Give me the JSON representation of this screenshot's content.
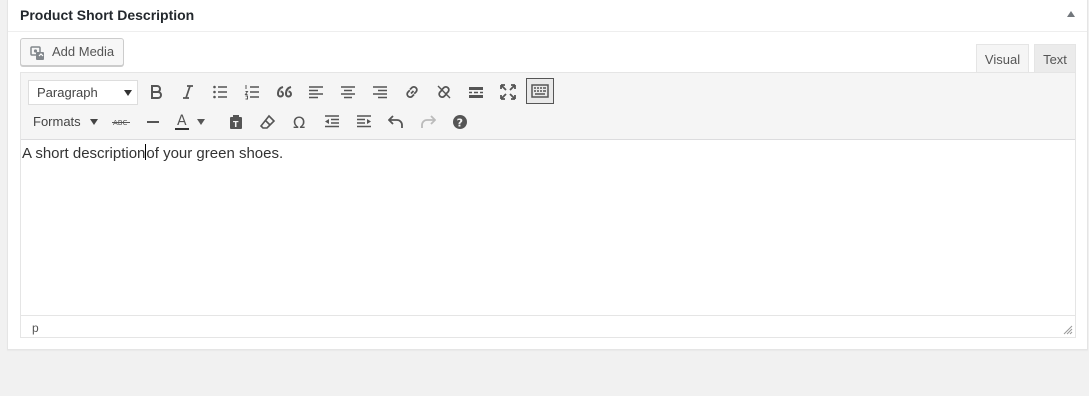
{
  "metabox": {
    "title": "Product Short Description"
  },
  "editor": {
    "add_media_label": "Add Media",
    "tabs": {
      "visual": "Visual",
      "text": "Text"
    },
    "format_select": {
      "selected": "Paragraph"
    },
    "formats_label": "Formats",
    "content": {
      "before_cursor": "A short description",
      "after_cursor": "of your green shoes."
    },
    "status_path": "p"
  },
  "toolbar_row1_icons": [
    "bold-icon",
    "italic-icon",
    "bullet-list-icon",
    "numbered-list-icon",
    "blockquote-icon",
    "align-left-icon",
    "align-center-icon",
    "align-right-icon",
    "link-icon",
    "unlink-icon",
    "read-more-icon",
    "fullscreen-icon",
    "toolbar-toggle-icon"
  ],
  "toolbar_row2_icons": [
    "strikethrough-icon",
    "horizontal-line-icon",
    "text-color-icon",
    "paste-text-icon",
    "clear-formatting-icon",
    "special-character-icon",
    "outdent-icon",
    "indent-icon",
    "undo-icon",
    "redo-icon",
    "help-icon"
  ],
  "colors": {
    "icon": "#555555",
    "icon_disabled": "#bbbbbb",
    "text_color_underline": "#333333"
  }
}
